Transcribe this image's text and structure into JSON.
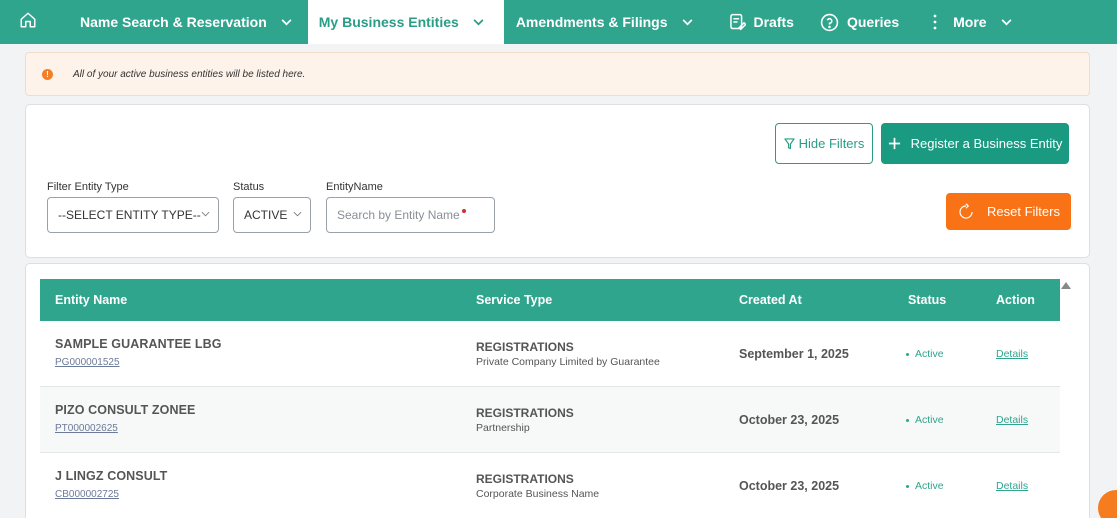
{
  "nav": {
    "home_icon": "home-icon",
    "items": [
      {
        "label": "Name Search & Reservation",
        "has_dropdown": true,
        "active": false
      },
      {
        "label": "My Business Entities",
        "has_dropdown": true,
        "active": true
      },
      {
        "label": "Amendments & Filings",
        "has_dropdown": true,
        "active": false
      },
      {
        "label": "Drafts",
        "icon": "drafts-icon",
        "active": false
      },
      {
        "label": "Queries",
        "icon": "help-circle-icon",
        "active": false
      },
      {
        "label": "More",
        "icon": "vertical-dots-icon",
        "has_dropdown": true,
        "active": false
      }
    ],
    "color": "#2fa58e"
  },
  "alert": {
    "text": "All of your active business entities will be listed here.",
    "icon": "exclamation-icon",
    "icon_color": "#f27f2a"
  },
  "filters": {
    "hide_filters_label": "Hide Filters",
    "register_label": "Register a Business Entity",
    "reset_label": "Reset Filters",
    "entity_type_label": "Filter Entity Type",
    "entity_type_value": "--SELECT ENTITY TYPE--",
    "status_label": "Status",
    "status_value": "ACTIVE",
    "entity_name_label": "EntityName",
    "entity_name_placeholder": "Search by Entity Name"
  },
  "table": {
    "columns": [
      "Entity Name",
      "Service Type",
      "Created At",
      "Status",
      "Action"
    ],
    "rows": [
      {
        "name": "SAMPLE GUARANTEE LBG",
        "id": "PG000001525",
        "service": "REGISTRATIONS",
        "service_sub": "Private Company Limited by Guarantee",
        "created": "September 1, 2025",
        "status": "Active",
        "action": "Details"
      },
      {
        "name": "PIZO CONSULT ZONEE",
        "id": "PT000002625",
        "service": "REGISTRATIONS",
        "service_sub": "Partnership",
        "created": "October 23, 2025",
        "status": "Active",
        "action": "Details"
      },
      {
        "name": "J LINGZ CONSULT",
        "id": "CB000002725",
        "service": "REGISTRATIONS",
        "service_sub": "Corporate Business Name",
        "created": "October 23, 2025",
        "status": "Active",
        "action": "Details"
      }
    ]
  },
  "colors": {
    "primary": "#2fa58e",
    "reset": "#f97316"
  }
}
